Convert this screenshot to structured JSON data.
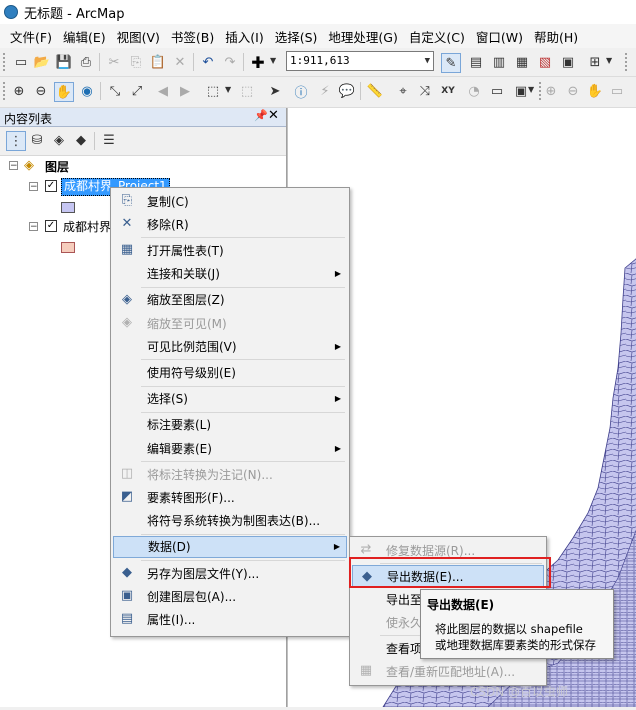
{
  "window": {
    "title": "无标题 - ArcMap"
  },
  "menubar": [
    {
      "label": "文件(F)"
    },
    {
      "label": "编辑(E)"
    },
    {
      "label": "视图(V)"
    },
    {
      "label": "书签(B)"
    },
    {
      "label": "插入(I)"
    },
    {
      "label": "选择(S)"
    },
    {
      "label": "地理处理(G)"
    },
    {
      "label": "自定义(C)"
    },
    {
      "label": "窗口(W)"
    },
    {
      "label": "帮助(H)"
    }
  ],
  "toolbar": {
    "scale_value": "1:911,613"
  },
  "toc": {
    "title": "内容列表",
    "root": "图层",
    "layers": [
      {
        "name": "成都村界_Project1",
        "checked": true,
        "selected": true,
        "swatch": "#c6c6f2"
      },
      {
        "name": "成都村界",
        "checked": true,
        "selected": false,
        "swatch": "#f6cdbd"
      }
    ]
  },
  "context_menu": [
    {
      "label": "复制(C)",
      "icon": "copy-icon",
      "glyph": "⎘",
      "enabled": true
    },
    {
      "label": "移除(R)",
      "icon": "remove-icon",
      "glyph": "✕",
      "enabled": true
    },
    {
      "label": "打开属性表(T)",
      "icon": "table-icon",
      "glyph": "▦",
      "enabled": true
    },
    {
      "label": "连接和关联(J)",
      "icon": "",
      "glyph": "",
      "enabled": true,
      "submenu": true
    },
    {
      "label": "缩放至图层(Z)",
      "icon": "zoom-layer-icon",
      "glyph": "◈",
      "enabled": true
    },
    {
      "label": "缩放至可见(M)",
      "icon": "zoom-visible-icon",
      "glyph": "◈",
      "enabled": false
    },
    {
      "label": "可见比例范围(V)",
      "icon": "",
      "glyph": "",
      "enabled": true,
      "submenu": true
    },
    {
      "label": "使用符号级别(E)",
      "icon": "",
      "glyph": "",
      "enabled": true
    },
    {
      "label": "选择(S)",
      "icon": "",
      "glyph": "",
      "enabled": true,
      "submenu": true
    },
    {
      "label": "标注要素(L)",
      "icon": "",
      "glyph": "",
      "enabled": true
    },
    {
      "label": "编辑要素(E)",
      "icon": "",
      "glyph": "",
      "enabled": true,
      "submenu": true
    },
    {
      "label": "将标注转换为注记(N)...",
      "icon": "convert-labels-icon",
      "glyph": "◫",
      "enabled": false
    },
    {
      "label": "要素转图形(F)...",
      "icon": "features-to-graphics-icon",
      "glyph": "◩",
      "enabled": true
    },
    {
      "label": "将符号系统转换为制图表达(B)...",
      "icon": "",
      "glyph": "",
      "enabled": true
    },
    {
      "label": "数据(D)",
      "icon": "",
      "glyph": "",
      "enabled": true,
      "submenu": true,
      "highlighted": true
    },
    {
      "label": "另存为图层文件(Y)...",
      "icon": "layer-file-icon",
      "glyph": "◆",
      "enabled": true
    },
    {
      "label": "创建图层包(A)...",
      "icon": "layer-package-icon",
      "glyph": "▣",
      "enabled": true
    },
    {
      "label": "属性(I)...",
      "icon": "properties-icon",
      "glyph": "▤",
      "enabled": true
    }
  ],
  "data_submenu": [
    {
      "label": "修复数据源(R)...",
      "icon": "repair-icon",
      "glyph": "⇄",
      "enabled": false
    },
    {
      "label": "导出数据(E)...",
      "icon": "export-data-icon",
      "glyph": "◆",
      "enabled": true,
      "highlighted": true
    },
    {
      "label": "导出至",
      "icon": "",
      "glyph": "",
      "enabled": true
    },
    {
      "label": "使永久",
      "icon": "",
      "glyph": "",
      "enabled": false
    },
    {
      "label": "查看项",
      "icon": "",
      "glyph": "",
      "enabled": true
    },
    {
      "label": "查看/重新匹配地址(A)...",
      "icon": "rematch-icon",
      "glyph": "▦",
      "enabled": false
    }
  ],
  "tooltip": {
    "title": "导出数据(E)",
    "line1": "将此图层的数据以 shapefile",
    "line2": "或地理数据库要素类的形式保存"
  },
  "watermark": "CSDN @百以虫师",
  "colors": {
    "map_fill": "#c6c6ee",
    "map_edge": "#3d3d8a",
    "highlight": "#cde1f7",
    "selection": "#3399ff"
  }
}
